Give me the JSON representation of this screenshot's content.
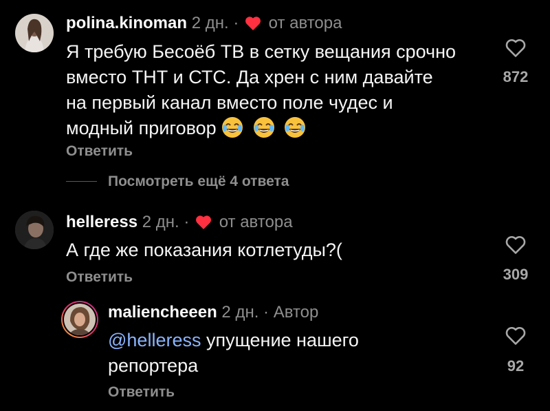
{
  "comments": [
    {
      "username": "polina.kinoman",
      "time": "2 дн.",
      "separator": "·",
      "author_like_label": "от автора",
      "text": "Я требую Бесоёб ТВ в сетку вещания срочно вместо ТНТ и СТС. Да хрен с ним давайте на первый канал вместо поле чудес и модный приговор",
      "emojis": [
        "😂",
        "😂",
        "😂"
      ],
      "reply_label": "Ответить",
      "view_replies_label": "Посмотреть ещё 4 ответа",
      "likes": "872"
    },
    {
      "username": "helleress",
      "time": "2 дн.",
      "separator": "·",
      "author_like_label": "от автора",
      "text": "А где же показания котлетуды?(",
      "reply_label": "Ответить",
      "likes": "309"
    },
    {
      "username": "maliencheeen",
      "time": "2 дн.",
      "separator": "·",
      "author_badge": "Автор",
      "mention": "@helleress",
      "text": "упущение нашего репортера",
      "reply_label": "Ответить",
      "likes": "92"
    }
  ],
  "colors": {
    "background": "#000000",
    "heart_red": "#ff3040",
    "mention": "#8ab4ff",
    "muted": "#8e8e8e"
  },
  "icons": [
    "heart-filled-icon",
    "heart-outline-icon",
    "laughing-emoji-icon"
  ]
}
